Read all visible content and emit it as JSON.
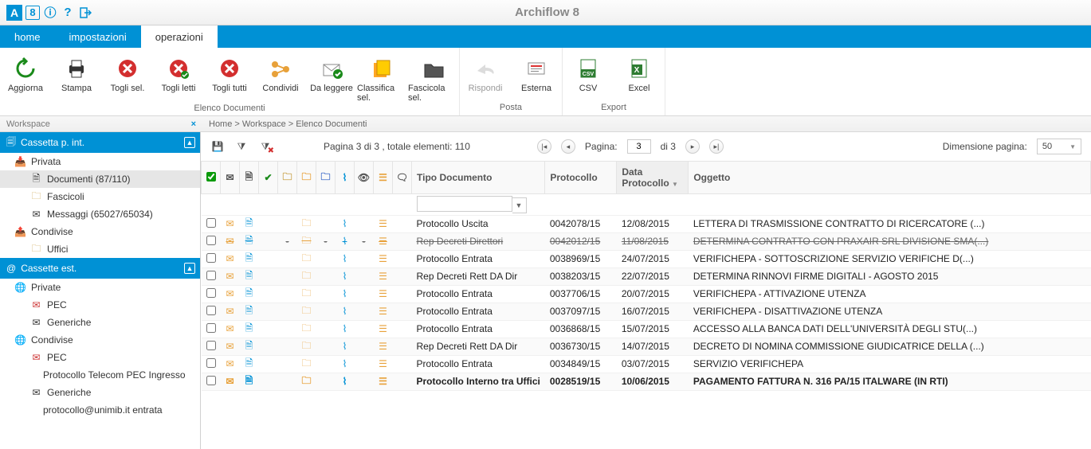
{
  "app_title": "Archiflow 8",
  "menu": {
    "home": "home",
    "impostazioni": "impostazioni",
    "operazioni": "operazioni"
  },
  "ribbon": {
    "group_docs": "Elenco Documenti",
    "group_posta": "Posta",
    "group_export": "Export",
    "aggiorna": "Aggiorna",
    "stampa": "Stampa",
    "togli_sel": "Togli sel.",
    "togli_letti": "Togli letti",
    "togli_tutti": "Togli tutti",
    "condividi": "Condividi",
    "da_leggere": "Da leggere",
    "classifica": "Classifica sel.",
    "fascicola": "Fascicola sel.",
    "rispondi": "Rispondi",
    "esterna": "Esterna",
    "csv": "CSV",
    "excel": "Excel"
  },
  "workspace_label": "Workspace",
  "breadcrumb": "Home > Workspace > Elenco Documenti",
  "sidebar": {
    "panel1": "Cassetta p. int.",
    "privata": "Privata",
    "documenti": "Documenti (87/110)",
    "fascicoli": "Fascicoli",
    "messaggi": "Messaggi (65027/65034)",
    "condivise": "Condivise",
    "uffici": "Uffici",
    "panel2": "Cassette est.",
    "private": "Private",
    "pec": "PEC",
    "generiche": "Generiche",
    "condivise2": "Condivise",
    "pec2": "PEC",
    "proto_telecom": "Protocollo Telecom PEC Ingresso",
    "generiche2": "Generiche",
    "proto_unimib": "protocollo@unimib.it entrata"
  },
  "pager": {
    "summary": "Pagina 3 di 3 , totale elementi: 110",
    "pagina_label": "Pagina:",
    "page_value": "3",
    "di": "di 3",
    "dim_label": "Dimensione pagina:",
    "dim_value": "50"
  },
  "columns": {
    "tipo": "Tipo Documento",
    "protocollo": "Protocollo",
    "data": "Data Protocollo",
    "oggetto": "Oggetto"
  },
  "rows": [
    {
      "tipo": "Protocollo Uscita",
      "proto": "0042078/15",
      "data": "12/08/2015",
      "ogg": "LETTERA DI TRASMISSIONE CONTRATTO DI RICERCATORE (...)",
      "struck": false,
      "bold": false,
      "dash": false
    },
    {
      "tipo": "Rep Decreti Direttori",
      "proto": "0042012/15",
      "data": "11/08/2015",
      "ogg": "DETERMINA CONTRATTO CON PRAXAIR SRL DIVISIONE SMA(...)",
      "struck": true,
      "bold": false,
      "dash": true
    },
    {
      "tipo": "Protocollo Entrata",
      "proto": "0038969/15",
      "data": "24/07/2015",
      "ogg": "VERIFICHEPA - SOTTOSCRIZIONE SERVIZIO VERIFICHE D(...)",
      "struck": false,
      "bold": false,
      "dash": false
    },
    {
      "tipo": "Rep Decreti Rett DA Dir",
      "proto": "0038203/15",
      "data": "22/07/2015",
      "ogg": "DETERMINA RINNOVI FIRME DIGITALI - AGOSTO 2015",
      "struck": false,
      "bold": false,
      "dash": false
    },
    {
      "tipo": "Protocollo Entrata",
      "proto": "0037706/15",
      "data": "20/07/2015",
      "ogg": "VERIFICHEPA - ATTIVAZIONE UTENZA",
      "struck": false,
      "bold": false,
      "dash": false
    },
    {
      "tipo": "Protocollo Entrata",
      "proto": "0037097/15",
      "data": "16/07/2015",
      "ogg": "VERIFICHEPA - DISATTIVAZIONE UTENZA",
      "struck": false,
      "bold": false,
      "dash": false
    },
    {
      "tipo": "Protocollo Entrata",
      "proto": "0036868/15",
      "data": "15/07/2015",
      "ogg": "ACCESSO ALLA BANCA DATI DELL'UNIVERSITÀ DEGLI STU(...)",
      "struck": false,
      "bold": false,
      "dash": false
    },
    {
      "tipo": "Rep Decreti Rett DA Dir",
      "proto": "0036730/15",
      "data": "14/07/2015",
      "ogg": "DECRETO DI NOMINA COMMISSIONE GIUDICATRICE DELLA (...)",
      "struck": false,
      "bold": false,
      "dash": false
    },
    {
      "tipo": "Protocollo Entrata",
      "proto": "0034849/15",
      "data": "03/07/2015",
      "ogg": "SERVIZIO VERIFICHEPA",
      "struck": false,
      "bold": false,
      "dash": false
    },
    {
      "tipo": "Protocollo Interno tra Uffici",
      "proto": "0028519/15",
      "data": "10/06/2015",
      "ogg": "PAGAMENTO FATTURA N. 316 PA/15 ITALWARE (IN RTI)",
      "struck": false,
      "bold": true,
      "dash": false
    }
  ]
}
